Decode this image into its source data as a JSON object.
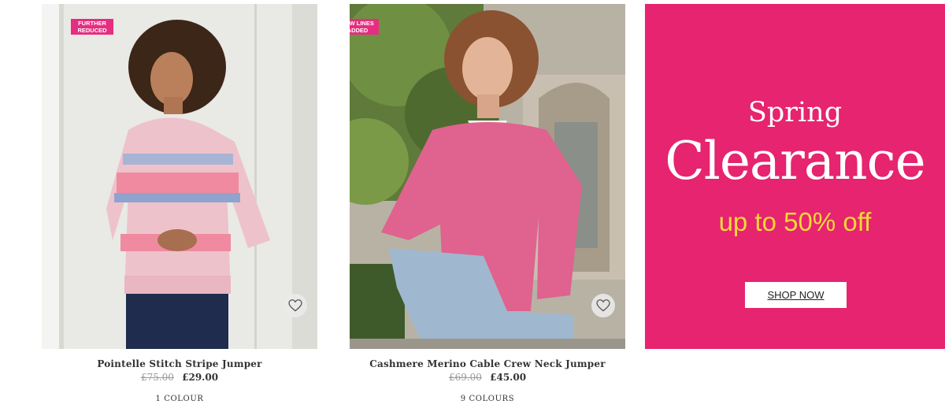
{
  "products": [
    {
      "badge": "FURTHER\nREDUCED",
      "name": "Pointelle Stitch Stripe Jumper",
      "was_price": "£75.00",
      "price": "£29.00",
      "colours": "1 COLOUR"
    },
    {
      "badge": "NEW LINES\nADDED",
      "name": "Cashmere Merino Cable Crew Neck Jumper",
      "was_price": "£69.00",
      "price": "£45.00",
      "colours": "9 COLOURS"
    }
  ],
  "promo": {
    "line1": "Spring",
    "line2": "Clearance",
    "line3": "up to 50% off",
    "button": "SHOP NOW",
    "bg_color": "#e6246f",
    "accent_color": "#f2d838"
  },
  "colors": {
    "badge": "#e62d80",
    "text": "#333333"
  },
  "icons": {
    "wishlist": "heart-outline-icon"
  }
}
